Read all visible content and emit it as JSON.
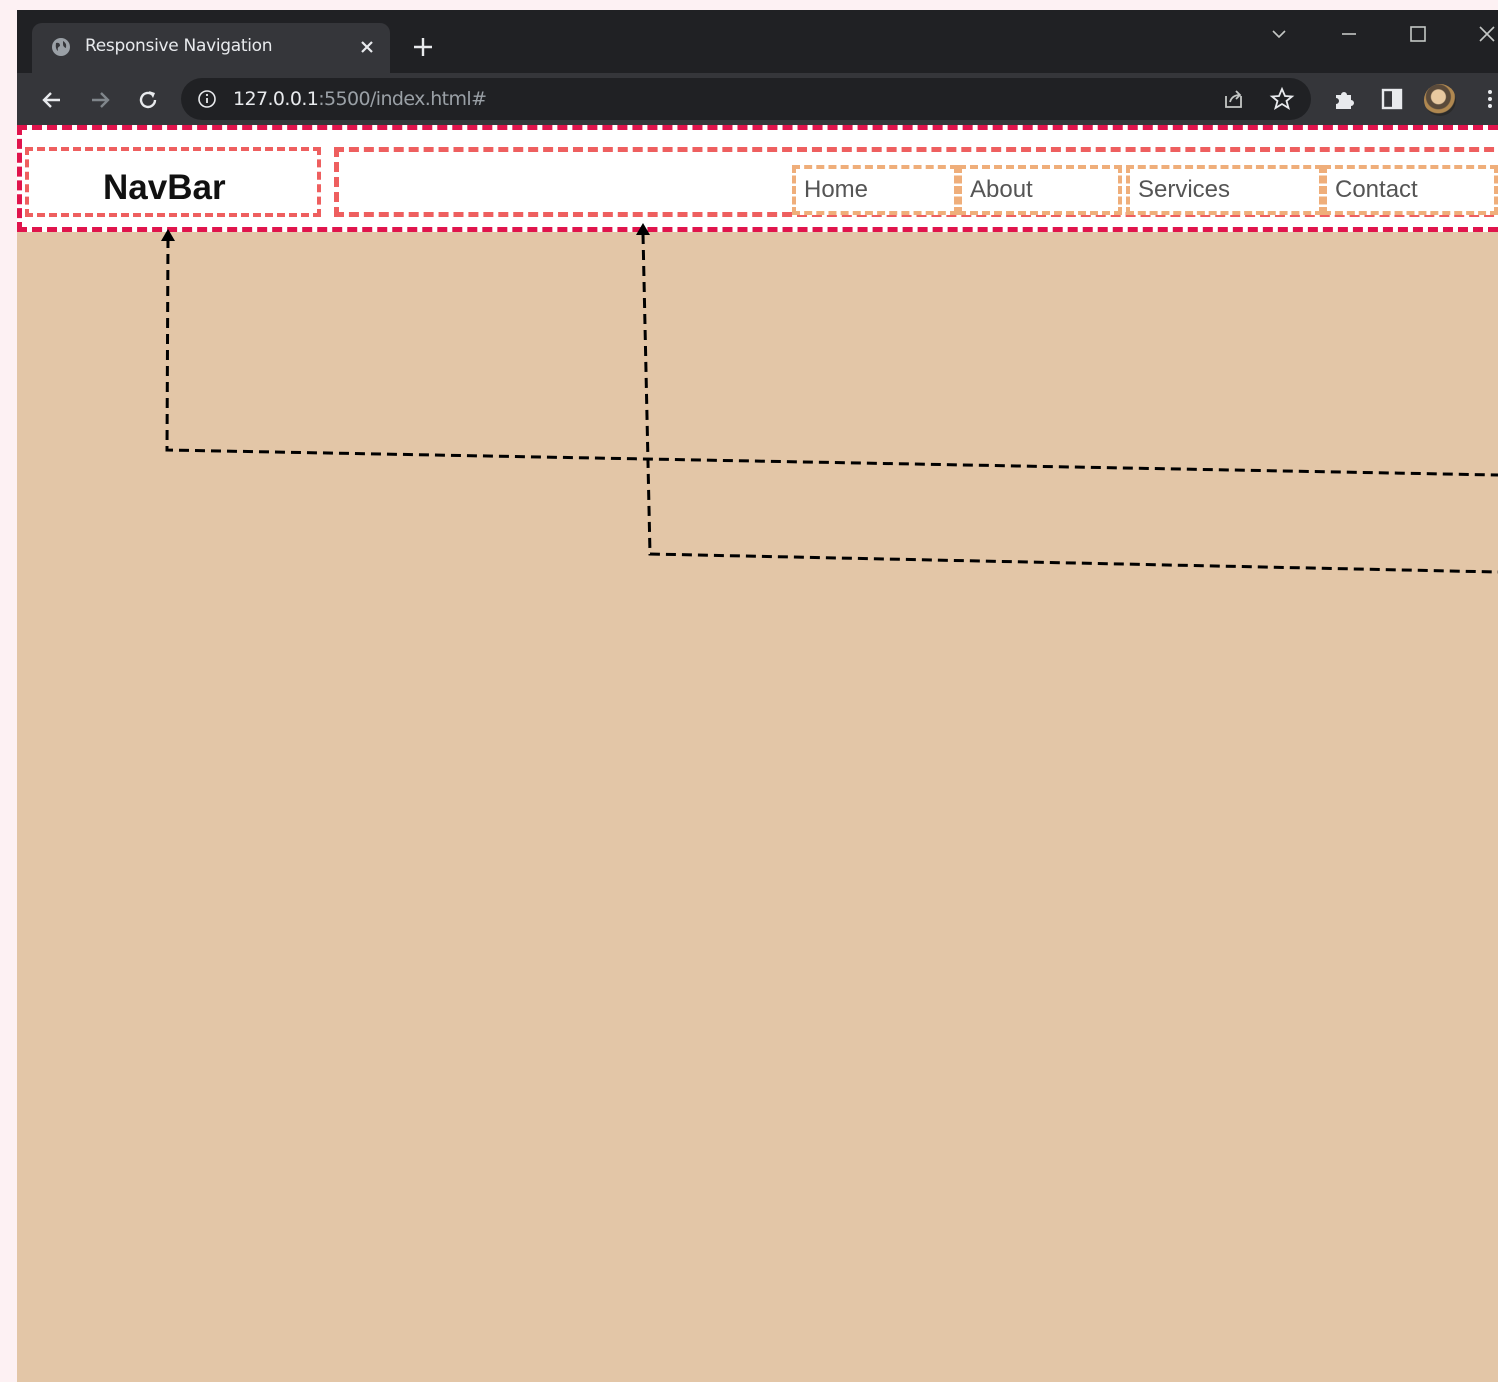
{
  "browser": {
    "tab_title": "Responsive Navigation",
    "url_host": "127.0.0.1",
    "url_rest": ":5500/index.html#"
  },
  "page": {
    "brand": "NavBar",
    "menu": [
      {
        "label": "Home"
      },
      {
        "label": "About"
      },
      {
        "label": "Services"
      },
      {
        "label": "Contact"
      }
    ]
  },
  "colors": {
    "page_bg": "#e3c6a7",
    "navbar_border": "#e0144c",
    "inner_border": "#ee5f5f",
    "item_border": "#efae7a"
  }
}
